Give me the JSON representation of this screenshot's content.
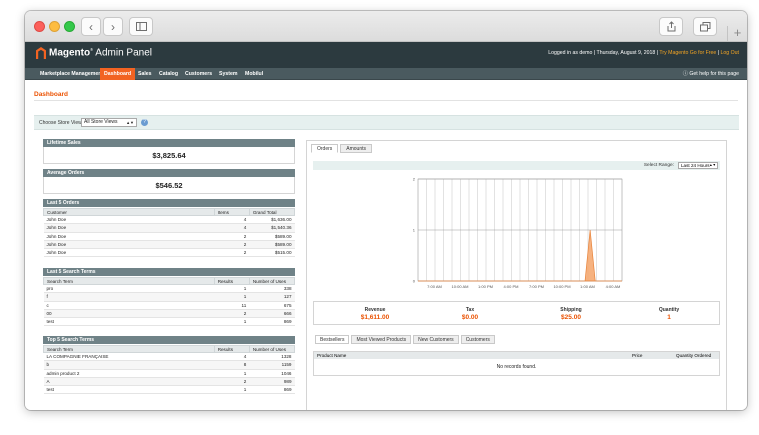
{
  "header": {
    "logo_brand": "Magento",
    "logo_suffix": "Admin Panel",
    "logged_in": "Logged in as demo",
    "date": "Thursday, August 9, 2018",
    "try_link": "Try Magento Go for Free",
    "logout": "Log Out"
  },
  "nav": {
    "items": [
      "Marketplace Management",
      "Dashboard",
      "Sales",
      "Catalog",
      "Customers",
      "System",
      "Mobilul"
    ],
    "active": "Dashboard",
    "help": "Get help for this page"
  },
  "page": {
    "title": "Dashboard",
    "store_label": "Choose Store View:",
    "store_value": "All Store Views"
  },
  "lifetime_sales": {
    "label": "Lifetime Sales",
    "value": "$3,825.64"
  },
  "average_orders": {
    "label": "Average Orders",
    "value": "$546.52"
  },
  "last_orders": {
    "title": "Last 5 Orders",
    "columns": [
      "Customer",
      "Items",
      "Grand Total"
    ],
    "rows": [
      [
        "John Doe",
        "4",
        "$1,636.00"
      ],
      [
        "John Doe",
        "4",
        "$1,540.36"
      ],
      [
        "John Doe",
        "2",
        "$589.00"
      ],
      [
        "John Doe",
        "2",
        "$589.00"
      ],
      [
        "John Doe",
        "2",
        "$515.00"
      ]
    ]
  },
  "last_search": {
    "title": "Last 5 Search Terms",
    "columns": [
      "Search Term",
      "Results",
      "Number of Uses"
    ],
    "rows": [
      [
        "pro",
        "1",
        "338"
      ],
      [
        "f",
        "1",
        "127"
      ],
      [
        "c",
        "11",
        "675"
      ],
      [
        "00",
        "2",
        "666"
      ],
      [
        "test",
        "1",
        "869"
      ]
    ]
  },
  "top_search": {
    "title": "Top 5 Search Terms",
    "columns": [
      "Search Term",
      "Results",
      "Number of Uses"
    ],
    "rows": [
      [
        "LA COMPAGNIE FRANÇAISE",
        "4",
        "1328"
      ],
      [
        "b",
        "8",
        "1159"
      ],
      [
        "admin product 2",
        "1",
        "1046"
      ],
      [
        "A",
        "2",
        "989"
      ],
      [
        "test",
        "1",
        "869"
      ]
    ]
  },
  "chart_tabs": [
    "Orders",
    "Amounts"
  ],
  "range": {
    "label": "Select Range:",
    "value": "Last 24 Hours"
  },
  "chart_data": {
    "type": "area",
    "x_ticks": [
      "7:00 AM",
      "10:00 AM",
      "1:00 PM",
      "4:00 PM",
      "7:00 PM",
      "10:00 PM",
      "1:00 AM",
      "4:00 AM"
    ],
    "y_ticks": [
      "0",
      "1",
      "2"
    ],
    "ylim": [
      0,
      2
    ],
    "points_x_index": [
      0,
      6.55,
      6.75,
      6.95,
      8
    ],
    "values": [
      0,
      0,
      1,
      0,
      0
    ],
    "color": "#f5a46a"
  },
  "totals": [
    {
      "label": "Revenue",
      "value": "$1,611.00"
    },
    {
      "label": "Tax",
      "value": "$0.00"
    },
    {
      "label": "Shipping",
      "value": "$25.00"
    },
    {
      "label": "Quantity",
      "value": "1"
    }
  ],
  "bottom_tabs": [
    "Bestsellers",
    "Most Viewed Products",
    "New Customers",
    "Customers"
  ],
  "bestsellers": {
    "columns": [
      "Product Name",
      "Price",
      "Quantity Ordered"
    ],
    "empty": "No records found."
  },
  "colors": {
    "accent": "#eb5202",
    "header": "#2c3a3f",
    "nav": "#4a5a5f"
  }
}
